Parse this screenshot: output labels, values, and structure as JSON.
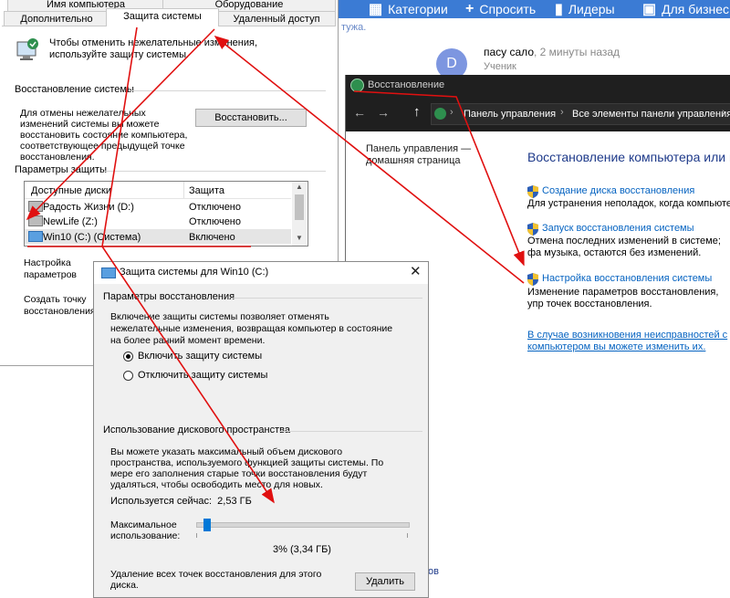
{
  "site": {
    "nav": [
      {
        "icon": "grid-icon",
        "label": "Категории"
      },
      {
        "icon": "plus-icon",
        "label": "Спросить"
      },
      {
        "icon": "leaderboard-icon",
        "label": "Лидеры"
      },
      {
        "icon": "briefcase-icon",
        "label": "Для бизнес"
      }
    ],
    "side_text": "тужа.",
    "answer": {
      "avatar_letter": "D",
      "author": "пасу сало",
      "time": ", 2 минуты назад",
      "role": "Ученик"
    },
    "bottom_fragment": "ов",
    "colors": {
      "bar": "#3b7bd4",
      "avatar": "#7d96e0"
    }
  },
  "sysprop": {
    "tabs_row1": [
      "Имя компьютера",
      "Оборудование"
    ],
    "tabs_row2": [
      "Дополнительно",
      "Защита системы",
      "Удаленный доступ"
    ],
    "intro": "Чтобы отменить нежелательные изменения, используйте защиту системы.",
    "restore_group": "Восстановление системы",
    "restore_text": "Для отмены нежелательных изменений системы вы можете восстановить состояние компьютера, соответствующее предыдущей точке восстановления.",
    "restore_button": "Восстановить...",
    "protect_group": "Параметры защиты",
    "columns": [
      "Доступные диски",
      "Защита"
    ],
    "disks": [
      {
        "name": "Радость Жизни (D:)",
        "state": "Отключено"
      },
      {
        "name": "NewLife (Z:)",
        "state": "Отключено"
      },
      {
        "name": "Win10 (C:) (Система)",
        "state": "Включено"
      }
    ],
    "configure_text": "Настройка параметров восстановления, управление дисковым пространством и удаление точек восстановления.",
    "create_text": "Создать точку восстановления для дисков с включенной функцией защиты системы."
  },
  "cpanel": {
    "title": "Восстановление",
    "breadcrumb": [
      "Панель управления",
      "Все элементы панели управления"
    ],
    "home_link": "Панель управления — домашняя страница",
    "heading": "Восстановление компьютера или в",
    "items": [
      {
        "link": "Создание диска восстановления",
        "desc": "Для устранения неполадок, когда компьютер не запускается, используется диск восстановления."
      },
      {
        "link": "Запуск восстановления системы",
        "desc": "Отмена последних изменений в системе; фа музыка, остаются без изменений."
      },
      {
        "link": "Настройка восстановления системы",
        "desc": "Изменение параметров восстановления, упр точек восстановления."
      }
    ],
    "help_link": "В случае возникновения неисправностей с компьютером вы можете изменить их."
  },
  "prot": {
    "title": "Защита системы для Win10 (C:)",
    "params_group": "Параметры восстановления",
    "params_text": "Включение защиты системы позволяет отменять нежелательные изменения, возвращая компьютер в состояние на более ранний момент времени.",
    "radio_on": "Включить защиту системы",
    "radio_off": "Отключить защиту системы",
    "usage_group": "Использование дискового пространства",
    "usage_text": "Вы можете указать максимальный объем дискового пространства, используемого функцией защиты системы. По мере его заполнения старые точки восстановления будут удаляться, чтобы освободить место для новых.",
    "used_label": "Используется сейчас:",
    "used_value": "2,53 ГБ",
    "max_label": "Максимальное использование:",
    "slider_fraction": 0.03,
    "slider_value": "3% (3,34 ГБ)",
    "delete_text": "Удаление всех точек восстановления для этого диска.",
    "delete_button": "Удалить"
  },
  "annotation": {
    "color": "#e01010"
  }
}
